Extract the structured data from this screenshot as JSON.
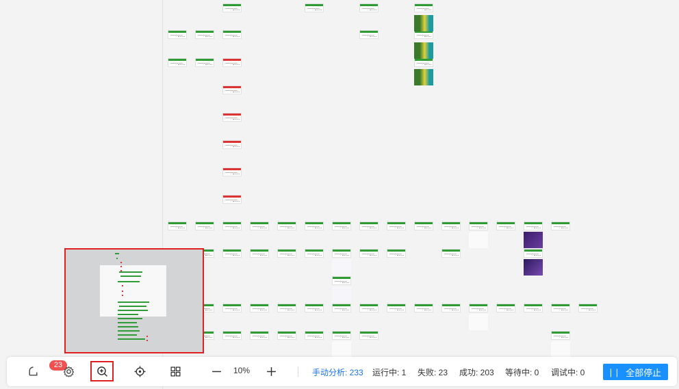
{
  "toolbar": {
    "notification_badge": "23",
    "icons": {
      "notification": "bell-outline-icon",
      "settings": "gear-icon",
      "zoom_in": "zoom-in-icon",
      "locate": "crosshair-icon",
      "layout": "grid-icon",
      "minus": "minus-icon",
      "plus": "plus-icon"
    },
    "zoom_level": "10%",
    "stats": {
      "manual": "手动分析: 233",
      "running": "运行中: 1",
      "failed": "失败: 23",
      "success": "成功: 203",
      "waiting": "等待中: 0",
      "debugging": "调试中: 0"
    },
    "stop_all_label": "全部停止"
  },
  "colors": {
    "success": "#2e9b35",
    "failed": "#dd3333",
    "primary": "#1890ff",
    "manual_stat": "#1a73e8",
    "highlight": "#e02020"
  }
}
